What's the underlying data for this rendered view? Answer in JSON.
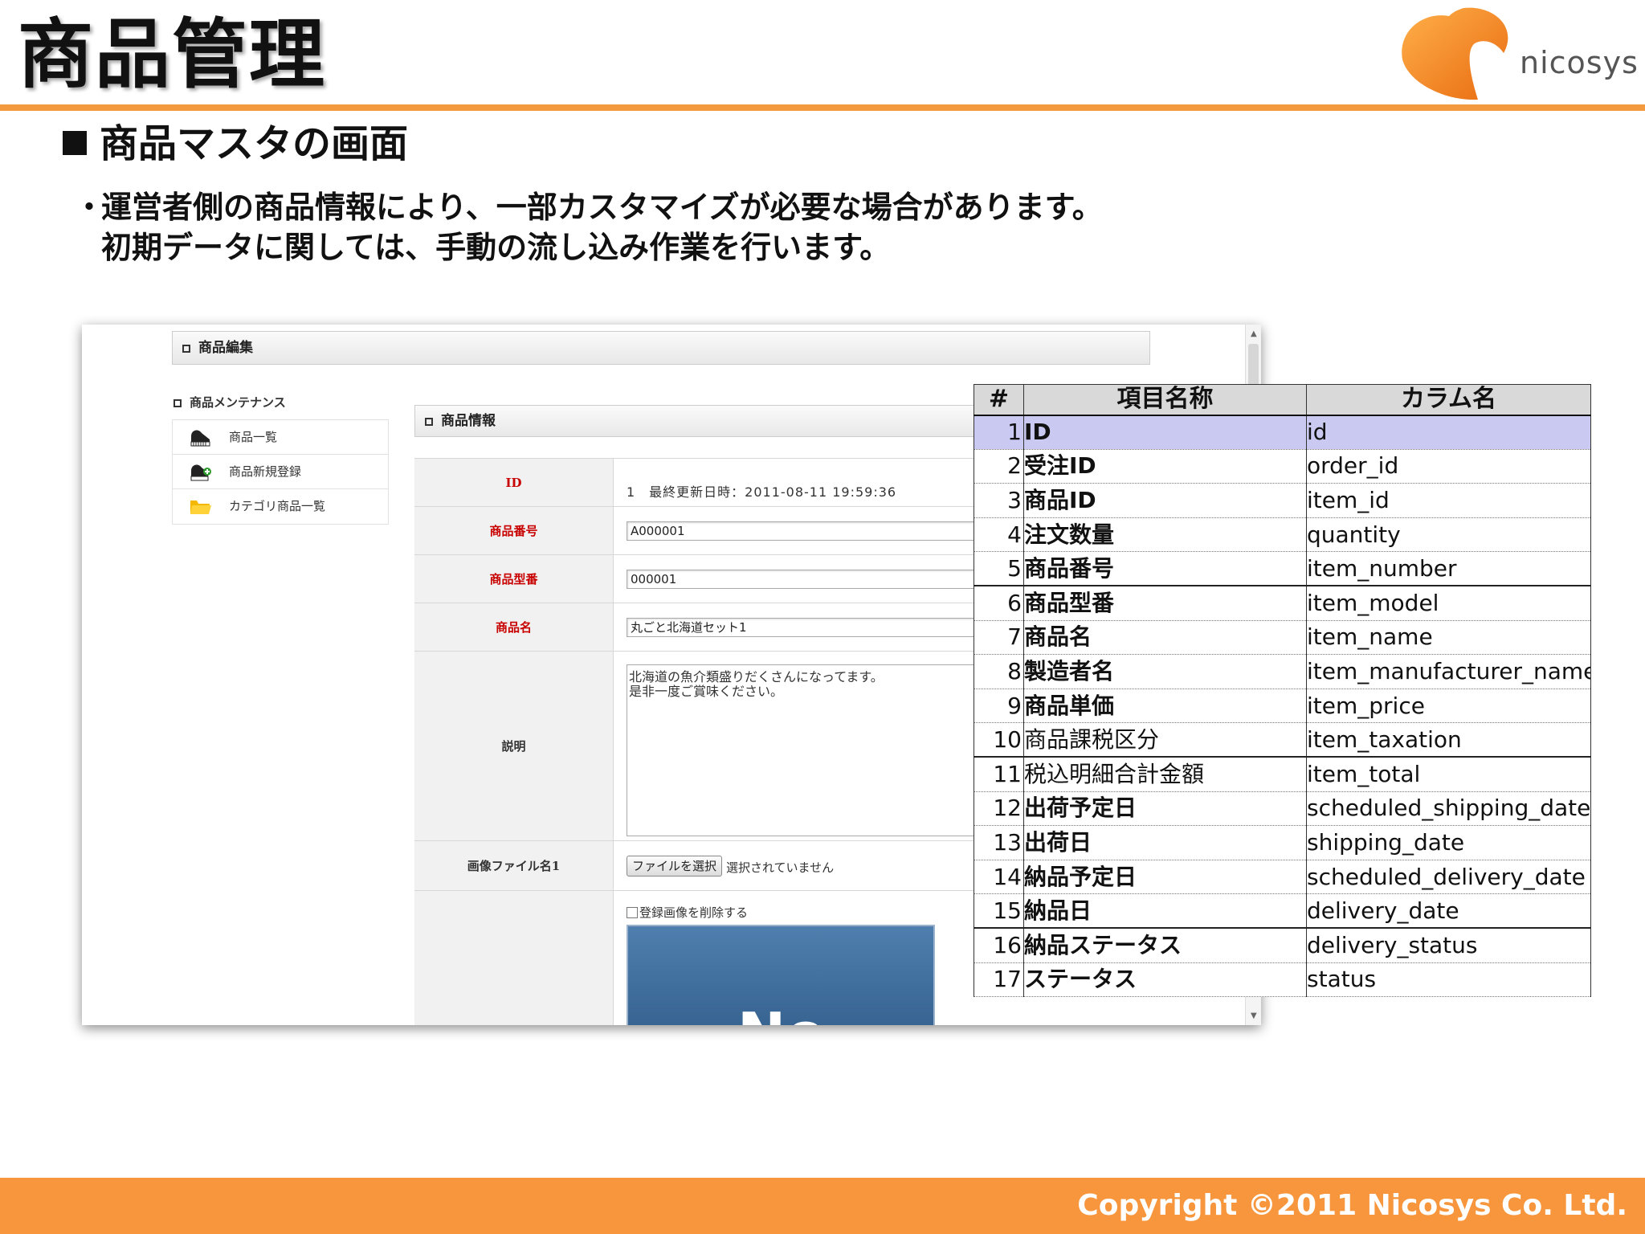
{
  "slide": {
    "title": "商品管理",
    "section_heading": "商品マスタの画面",
    "bullet_marker": "・",
    "bullet_line1": "運営者側の商品情報により、一部カスタマイズが必要な場合があります。",
    "bullet_line2": "初期データに関しては、手動の流し込み作業を行います。",
    "logo_text": "nicosys",
    "copyright": "Copyright ©2011 Nicosys Co. Ltd.",
    "colors": {
      "accent": "#f7963d",
      "rule": "#f39a3e",
      "selected_row": "#c9c9f2"
    }
  },
  "screenshot": {
    "edit_bar_title": "商品編集",
    "sidebar": {
      "heading": "商品メンテナンス",
      "items": [
        {
          "label": "商品一覧",
          "icon": "piano-icon"
        },
        {
          "label": "商品新規登録",
          "icon": "piano-add-icon"
        },
        {
          "label": "カテゴリ商品一覧",
          "icon": "folder-icon"
        }
      ]
    },
    "info_bar_title": "商品情報",
    "form": {
      "id_label": "ID",
      "id_value": "1　最終更新日時：2011-08-11 19:59:36",
      "number_label": "商品番号",
      "number_value": "A000001",
      "model_label": "商品型番",
      "model_value": "000001",
      "name_label": "商品名",
      "name_value": "丸ごと北海道セット1",
      "desc_label": "説明",
      "desc_value": "北海道の魚介類盛りだくさんになってます。\n是非一度ご賞味ください。",
      "image_label": "画像ファイル名1",
      "file_button": "ファイルを選択",
      "file_status": "選択されていません",
      "delete_image_label": "登録画像を削除する",
      "noimage_text": "No"
    }
  },
  "column_table": {
    "headers": [
      "#",
      "項目名称",
      "カラム名"
    ],
    "rows": [
      {
        "num": "1",
        "name": "ID",
        "column": "id"
      },
      {
        "num": "2",
        "name": "受注ID",
        "column": "order_id"
      },
      {
        "num": "3",
        "name": "商品ID",
        "column": "item_id"
      },
      {
        "num": "4",
        "name": "注文数量",
        "column": "quantity"
      },
      {
        "num": "5",
        "name": "商品番号",
        "column": "item_number"
      },
      {
        "num": "6",
        "name": "商品型番",
        "column": "item_model"
      },
      {
        "num": "7",
        "name": "商品名",
        "column": "item_name"
      },
      {
        "num": "8",
        "name": "製造者名",
        "column": "item_manufacturer_name"
      },
      {
        "num": "9",
        "name": "商品単価",
        "column": "item_price"
      },
      {
        "num": "10",
        "name": "商品課税区分",
        "column": "item_taxation"
      },
      {
        "num": "11",
        "name": "税込明細合計金額",
        "column": "item_total"
      },
      {
        "num": "12",
        "name": "出荷予定日",
        "column": "scheduled_shipping_date"
      },
      {
        "num": "13",
        "name": "出荷日",
        "column": "shipping_date"
      },
      {
        "num": "14",
        "name": "納品予定日",
        "column": "scheduled_delivery_date"
      },
      {
        "num": "15",
        "name": "納品日",
        "column": "delivery_date"
      },
      {
        "num": "16",
        "name": "納品ステータス",
        "column": "delivery_status"
      },
      {
        "num": "17",
        "name": "ステータス",
        "column": "status"
      }
    ]
  }
}
